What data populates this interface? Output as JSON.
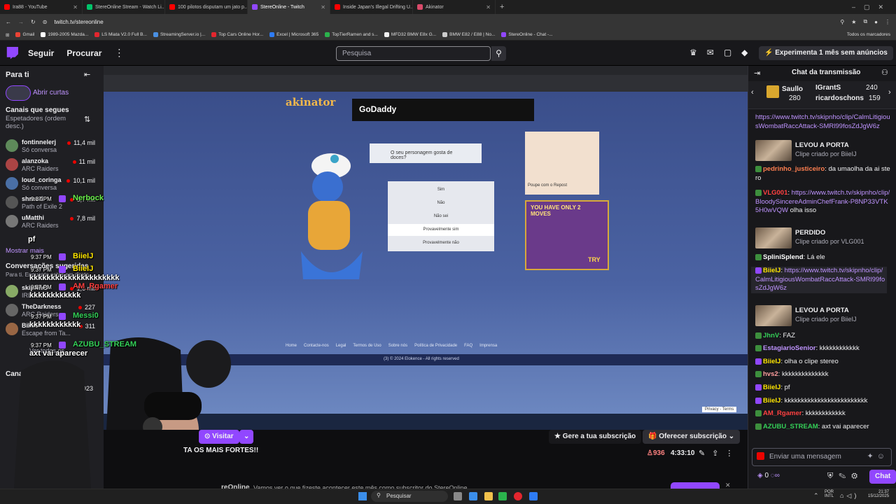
{
  "browser": {
    "tabs": [
      {
        "title": "Ira88 - YouTube",
        "color": "#ff0000"
      },
      {
        "title": "StereOnline Stream - Watch Li...",
        "color": "#00c46a"
      },
      {
        "title": "100 pilotos disputam um jato p...",
        "color": "#ff0000"
      },
      {
        "title": "StereOnline - Twitch",
        "color": "#9147ff"
      },
      {
        "title": "Inside Japan's Illegal Drifting U...",
        "color": "#ff0000"
      },
      {
        "title": "Akinator",
        "color": "#d94a6a"
      }
    ],
    "url": "twitch.tv/stereonline",
    "bookmarks": [
      {
        "label": "Gmail",
        "color": "#ea4335"
      },
      {
        "label": "1989-2005 Mazda...",
        "color": "#ffffff"
      },
      {
        "label": "LS Miata V2.0 Full B...",
        "color": "#e3262e"
      },
      {
        "label": "StreamingServer.io |...",
        "color": "#4a90e2"
      },
      {
        "label": "Top Cars Online Hor...",
        "color": "#e3262e"
      },
      {
        "label": "Excel | Microsoft 365",
        "color": "#2e7cf6"
      },
      {
        "label": "TopTierRamen and s...",
        "color": "#2bb24c"
      },
      {
        "label": "MFD32 BMW E8x G...",
        "color": "#f0f0f0"
      },
      {
        "label": "BMW E82 / E88 | No...",
        "color": "#cccccc"
      },
      {
        "label": "StereOnline - Chat -...",
        "color": "#9147ff"
      }
    ],
    "all_bookmarks": "Todos os marcadores"
  },
  "nav": {
    "follow": "Seguir",
    "browse": "Procurar",
    "search_placeholder": "Pesquisa",
    "turbo": "Experimenta 1 mês sem anúncios"
  },
  "sidebar": {
    "title": "Para ti",
    "shorts": "Abrir curtas",
    "followed_title": "Canais que segues",
    "sort_label": "Espetadores (ordem desc.)",
    "channels": [
      {
        "name": "fontinnelerj",
        "game": "Só conversa",
        "viewers": "11,4 mil",
        "color": "#5e8a5a"
      },
      {
        "name": "alanzoka",
        "game": "ARC Raiders",
        "viewers": "11 mil",
        "color": "#a44"
      },
      {
        "name": "loud_coringa",
        "game": "Só conversa",
        "viewers": "10,1 mil",
        "color": "#4a6fa5"
      },
      {
        "name": "shroud",
        "game": "Path of Exile 2",
        "viewers": "8,7 mil",
        "color": "#555"
      },
      {
        "name": "uMatthi",
        "game": "ARC Raiders",
        "viewers": "7,8 mil",
        "color": "#777"
      }
    ],
    "show_more": "Mostrar mais",
    "recommended_title": "Conversações sugeridas",
    "recommended_sub": "Para ti. Enquanto estás em direto.",
    "channels2": [
      {
        "name": "skipNhO",
        "game": "IRL",
        "viewers": "1,6 mil",
        "color": "#8a6"
      },
      {
        "name": "TheDarkness",
        "game": "ARC Raiders",
        "viewers": "227",
        "color": "#666"
      },
      {
        "name": "Bikes",
        "game": "Escape from Ta...",
        "viewers": "311",
        "color": "#964"
      }
    ],
    "see_all": "Ver todos os",
    "channels_label": "Cana",
    "count_923": "923"
  },
  "overlay_chat": [
    {
      "time": "9:37 PM",
      "user": "Nerbock",
      "msg": "",
      "color": "#69f04a"
    },
    {
      "time": "",
      "user": "",
      "msg": "pf",
      "color": "#ffffff"
    },
    {
      "time": "9:37 PM",
      "user": "BiieIJ",
      "msg": "",
      "color": "#ffe600"
    },
    {
      "time": "9:37 PM",
      "user": "BiieIJ",
      "msg": "kkkkkkkkkkkkkkkkkkkkk",
      "color": "#ffe600"
    },
    {
      "time": "9:37 PM",
      "user": "AM_Rgamer",
      "msg": "kkkkkkkkkkkk",
      "color": "#ff4040"
    },
    {
      "time": "9:37 PM",
      "user": "Messi0",
      "msg": "kkkkkkkkkkkk",
      "color": "#34d058"
    },
    {
      "time": "9:37 PM",
      "user": "AZUBU_STREAM",
      "msg": "axt vai aparecer",
      "color": "#34d058"
    }
  ],
  "video": {
    "akinator_question": "O seu personagem gosta de doces?",
    "answers": [
      "Sim",
      "Não",
      "Não sei",
      "Provavelmente sim",
      "Provavelmente não"
    ],
    "ad_brand": "GoDaddy",
    "ad_caption": "Poupe com o Repost",
    "game_ad": "YOU HAVE ONLY 2 MOVES",
    "game_try": "TRY",
    "footer_links": [
      "Home",
      "Contacte-nos",
      "Legal",
      "Termos de Uso",
      "Sobre nós",
      "Política de Privacidade",
      "FAQ",
      "Imprensa"
    ],
    "copyright": "(3) © 2024 Elokence - All rights reserved",
    "privacy": "Privacy - Terms"
  },
  "below_video": {
    "visit": "Visitar",
    "title_snippet": "TA   OS MAIS FORTES!!",
    "subscribe_gift": "Gere a tua subscrição",
    "offer_sub": "Oferecer subscrição",
    "viewers": "936",
    "uptime": "4:33:10",
    "channel_snippet": "reOnline",
    "desc_snippet": "Vamos ver o que fizeste acontecer este mês como subscritor do StereOnline"
  },
  "chat": {
    "title": "Chat da transmissão",
    "leaders": [
      {
        "name": "Saullo",
        "score": "280"
      },
      {
        "name": "IGrantS",
        "score": "240"
      },
      {
        "name": "ricardoschons",
        "score": "159"
      }
    ],
    "messages": [
      {
        "kind": "link",
        "user": "",
        "text": "https://www.twitch.tv/skipnho/clip/CalmLitigiousWombatRaccAttack-SMRl99fosZdJgW6z",
        "ucolor": "#bf94ff"
      },
      {
        "kind": "clip",
        "title": "LEVOU A PORTA",
        "by": "Clipe criado por BiieIJ"
      },
      {
        "kind": "msg",
        "user": "pedrinho_justiceiro",
        "text": "da umaolha da ai stero",
        "ucolor": "#ff7f50"
      },
      {
        "kind": "link",
        "user": "VLG001",
        "text": "https://www.twitch.tv/skipnho/clip/BloodySincereAdminChefFrank-P8NP33VTK5H0wVQW",
        "suffix": "olha isso",
        "ucolor": "#ff4040"
      },
      {
        "kind": "clip",
        "title": "PERDIDO",
        "by": "Clipe criado por VLG001"
      },
      {
        "kind": "msg",
        "user": "SpliniSplend",
        "text": "Lá ele",
        "ucolor": "#ffffff"
      },
      {
        "kind": "link",
        "user": "BiieIJ",
        "text": "https://www.twitch.tv/skipnho/clip/CalmLitigiousWombatRaccAttack-SMRl99fosZdJgW6z",
        "ucolor": "#ffe600"
      },
      {
        "kind": "clip",
        "title": "LEVOU A PORTA",
        "by": "Clipe criado por BiieIJ"
      },
      {
        "kind": "msg",
        "user": "JhnV",
        "text": "FAZ",
        "ucolor": "#34d058"
      },
      {
        "kind": "msg",
        "user": "EstagiarioSenior",
        "text": "kkkkkkkkkkkk",
        "ucolor": "#bf94ff"
      },
      {
        "kind": "msg",
        "user": "BiieIJ",
        "text": "olha o clipe stereo",
        "ucolor": "#ffe600"
      },
      {
        "kind": "msg",
        "user": "hvs2",
        "text": "kkkkkkkkkkkkkk",
        "ucolor": "#ff9f9f"
      },
      {
        "kind": "msg",
        "user": "BiieIJ",
        "text": "pf",
        "ucolor": "#ffe600"
      },
      {
        "kind": "msg",
        "user": "BiieIJ",
        "text": "kkkkkkkkkkkkkkkkkkkkkkkkk",
        "ucolor": "#ffe600"
      },
      {
        "kind": "msg",
        "user": "AM_Rgamer",
        "text": "kkkkkkkkkkkk",
        "ucolor": "#ff4040"
      },
      {
        "kind": "msg",
        "user": "AZUBU_STREAM",
        "text": "axt vai aparecer",
        "ucolor": "#34d058"
      }
    ],
    "input_placeholder": "Enviar uma mensagem",
    "points": "0",
    "chat_btn": "Chat"
  },
  "taskbar": {
    "search": "Pesquisar",
    "lang": "POR",
    "lang2": "INTL",
    "time": "21:37",
    "date": "15/12/2025"
  },
  "colors": {
    "twitch_purple": "#9147ff",
    "link": "#bf94ff"
  }
}
